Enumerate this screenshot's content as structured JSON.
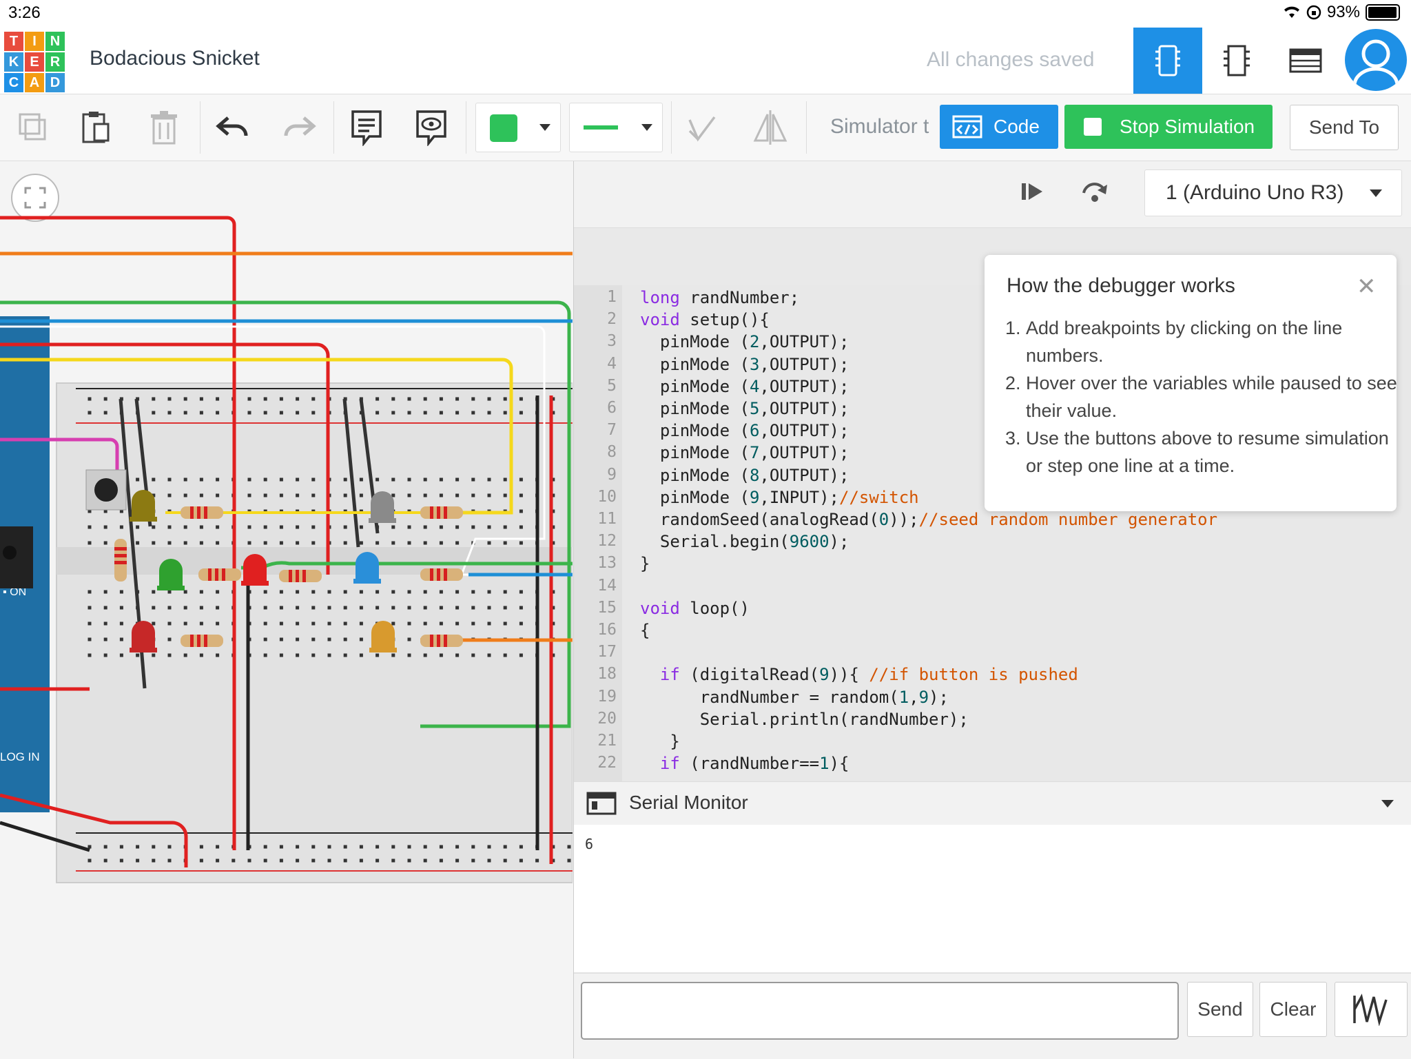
{
  "status_bar": {
    "time": "3:26",
    "battery": "93%"
  },
  "header": {
    "logo_letters": [
      "T",
      "I",
      "N",
      "K",
      "E",
      "R",
      "C",
      "A",
      "D"
    ],
    "logo_colors": [
      "#e84c3d",
      "#f39c12",
      "#2ec25a",
      "#3498db",
      "#e84c3d",
      "#2ec25a",
      "#1e90e6",
      "#f39c12",
      "#3498db"
    ],
    "document_name": "Bodacious Snicket",
    "save_status": "All changes saved"
  },
  "toolbar": {
    "simulator_label": "Simulator t",
    "code_label": "Code",
    "stop_label": "Stop Simulation",
    "send_to_label": "Send To",
    "fill_color": "#2ec25a",
    "line_color": "#2ec25a"
  },
  "code_panel": {
    "device": "1 (Arduino Uno R3)",
    "lines": [
      {
        "n": "1",
        "t": "long randNumber;"
      },
      {
        "n": "2",
        "t": "void setup(){"
      },
      {
        "n": "3",
        "t": "  pinMode (2,OUTPUT);"
      },
      {
        "n": "4",
        "t": "  pinMode (3,OUTPUT);"
      },
      {
        "n": "5",
        "t": "  pinMode (4,OUTPUT);"
      },
      {
        "n": "6",
        "t": "  pinMode (5,OUTPUT);"
      },
      {
        "n": "7",
        "t": "  pinMode (6,OUTPUT);"
      },
      {
        "n": "8",
        "t": "  pinMode (7,OUTPUT);"
      },
      {
        "n": "9",
        "t": "  pinMode (8,OUTPUT);"
      },
      {
        "n": "10",
        "t": "  pinMode (9,INPUT);//switch"
      },
      {
        "n": "11",
        "t": "  randomSeed(analogRead(0));//seed random number generator"
      },
      {
        "n": "12",
        "t": "  Serial.begin(9600);"
      },
      {
        "n": "13",
        "t": "}"
      },
      {
        "n": "14",
        "t": ""
      },
      {
        "n": "15",
        "t": "void loop()"
      },
      {
        "n": "16",
        "t": "{"
      },
      {
        "n": "17",
        "t": ""
      },
      {
        "n": "18",
        "t": "  if (digitalRead(9)){ //if button is pushed"
      },
      {
        "n": "19",
        "t": "      randNumber = random(1,9);"
      },
      {
        "n": "20",
        "t": "      Serial.println(randNumber);"
      },
      {
        "n": "21",
        "t": "   }"
      },
      {
        "n": "22",
        "t": "  if (randNumber==1){"
      }
    ]
  },
  "debugger_tip": {
    "title": "How the debugger works",
    "items": [
      "Add breakpoints by clicking on the line numbers.",
      "Hover over the variables while paused to see their value.",
      "Use the buttons above to resume simulation or step one line at a time."
    ]
  },
  "serial_monitor": {
    "title": "Serial Monitor",
    "output": "6",
    "input_value": "",
    "send_label": "Send",
    "clear_label": "Clear"
  },
  "colors": {
    "accent": "#1e90e6",
    "green": "#2ec25a"
  }
}
